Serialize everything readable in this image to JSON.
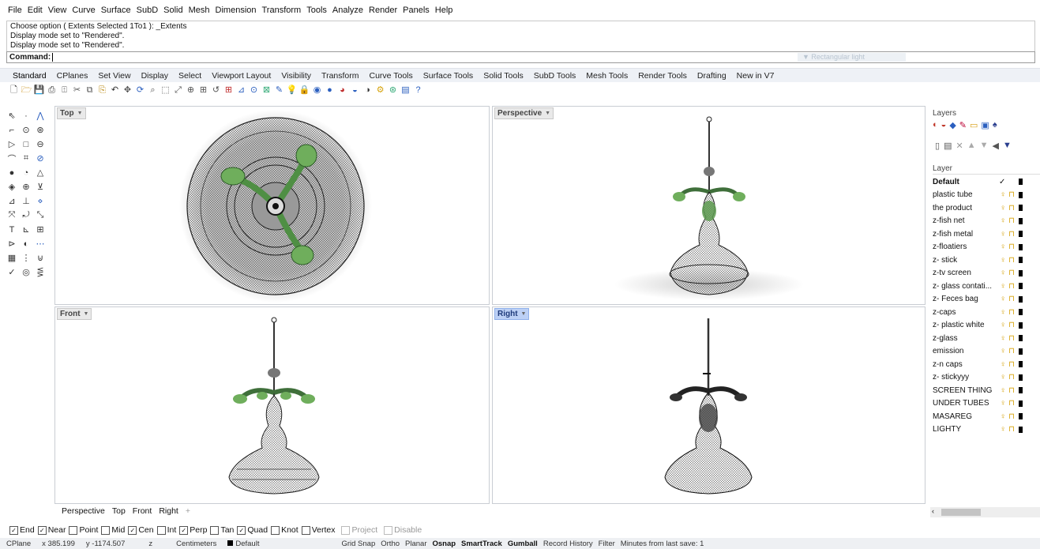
{
  "menu": [
    "File",
    "Edit",
    "View",
    "Curve",
    "Surface",
    "SubD",
    "Solid",
    "Mesh",
    "Dimension",
    "Transform",
    "Tools",
    "Analyze",
    "Render",
    "Panels",
    "Help"
  ],
  "command_history": [
    "Choose option ( Extents  Selected  1To1 ): _Extents",
    "Display mode set to \"Rendered\".",
    "Display mode set to \"Rendered\"."
  ],
  "command_prompt": "Command:",
  "command_ghost": "Rectangular light",
  "toolbar_tabs": [
    "Standard",
    "CPlanes",
    "Set View",
    "Display",
    "Select",
    "Viewport Layout",
    "Visibility",
    "Transform",
    "Curve Tools",
    "Surface Tools",
    "Solid Tools",
    "SubD Tools",
    "Mesh Tools",
    "Render Tools",
    "Drafting",
    "New in V7"
  ],
  "active_tab": "Standard",
  "toolbar_icons": [
    "new-icon",
    "open-icon",
    "save-icon",
    "print-icon",
    "import-icon",
    "cut-icon",
    "copy-icon",
    "paste-icon",
    "undo-icon",
    "pan-icon",
    "rotate-view-icon",
    "zoom-icon",
    "zoom-window-icon",
    "zoom-extents-icon",
    "zoom-selected-icon",
    "zoom-dynamic-icon",
    "undo-view-icon",
    "four-viewports-icon",
    "cplane-icon",
    "object-snap-icon",
    "grid-icon",
    "properties-icon",
    "light-icon",
    "lock-icon",
    "shaded-icon",
    "rendered-icon",
    "material-icon",
    "render-icon",
    "environment-icon",
    "tool-icon",
    "analysis-icon",
    "layer-icon",
    "help-icon"
  ],
  "viewports": {
    "top": {
      "label": "Top"
    },
    "perspective": {
      "label": "Perspective"
    },
    "front": {
      "label": "Front"
    },
    "right": {
      "label": "Right"
    }
  },
  "viewport_tabs": [
    "Perspective",
    "Top",
    "Front",
    "Right",
    "+"
  ],
  "layers": {
    "panel_title": "Layers",
    "column_header": "Layer",
    "items": [
      {
        "name": "Default",
        "current": true
      },
      {
        "name": "plastic tube"
      },
      {
        "name": "the product"
      },
      {
        "name": "z-fish net"
      },
      {
        "name": "z-fish metal"
      },
      {
        "name": "z-floatiers"
      },
      {
        "name": "z- stick"
      },
      {
        "name": "z-tv screen"
      },
      {
        "name": "z- glass contati..."
      },
      {
        "name": "z- Feces bag"
      },
      {
        "name": "z-caps"
      },
      {
        "name": "z- plastic white"
      },
      {
        "name": "z-glass"
      },
      {
        "name": "emission"
      },
      {
        "name": "z-n caps"
      },
      {
        "name": "z- stickyyy"
      },
      {
        "name": "SCREEN THING"
      },
      {
        "name": "UNDER TUBES"
      },
      {
        "name": "MASAREG"
      },
      {
        "name": "LIGHTY"
      }
    ]
  },
  "osnaps": [
    {
      "label": "End",
      "checked": true
    },
    {
      "label": "Near",
      "checked": true
    },
    {
      "label": "Point",
      "checked": false
    },
    {
      "label": "Mid",
      "checked": false
    },
    {
      "label": "Cen",
      "checked": true
    },
    {
      "label": "Int",
      "checked": false
    },
    {
      "label": "Perp",
      "checked": true
    },
    {
      "label": "Tan",
      "checked": false
    },
    {
      "label": "Quad",
      "checked": true
    },
    {
      "label": "Knot",
      "checked": false
    },
    {
      "label": "Vertex",
      "checked": false
    },
    {
      "label": "Project",
      "checked": false,
      "disabled": true
    },
    {
      "label": "Disable",
      "checked": false,
      "disabled": true
    }
  ],
  "status": {
    "cplane": "CPlane",
    "x": "x 385.199",
    "y": "y -1174.507",
    "z": "z",
    "units": "Centimeters",
    "layer": "Default",
    "toggles": [
      "Grid Snap",
      "Ortho",
      "Planar",
      "Osnap",
      "SmartTrack",
      "Gumball",
      "Record History",
      "Filter"
    ],
    "bold_toggles": [
      "Osnap",
      "SmartTrack",
      "Gumball"
    ],
    "save_info": "Minutes from last save: 1"
  },
  "colors": {
    "accent_green": "#6fae5c",
    "active_viewport": "#bcd0f5",
    "layer_lock": "#d6a30c"
  }
}
